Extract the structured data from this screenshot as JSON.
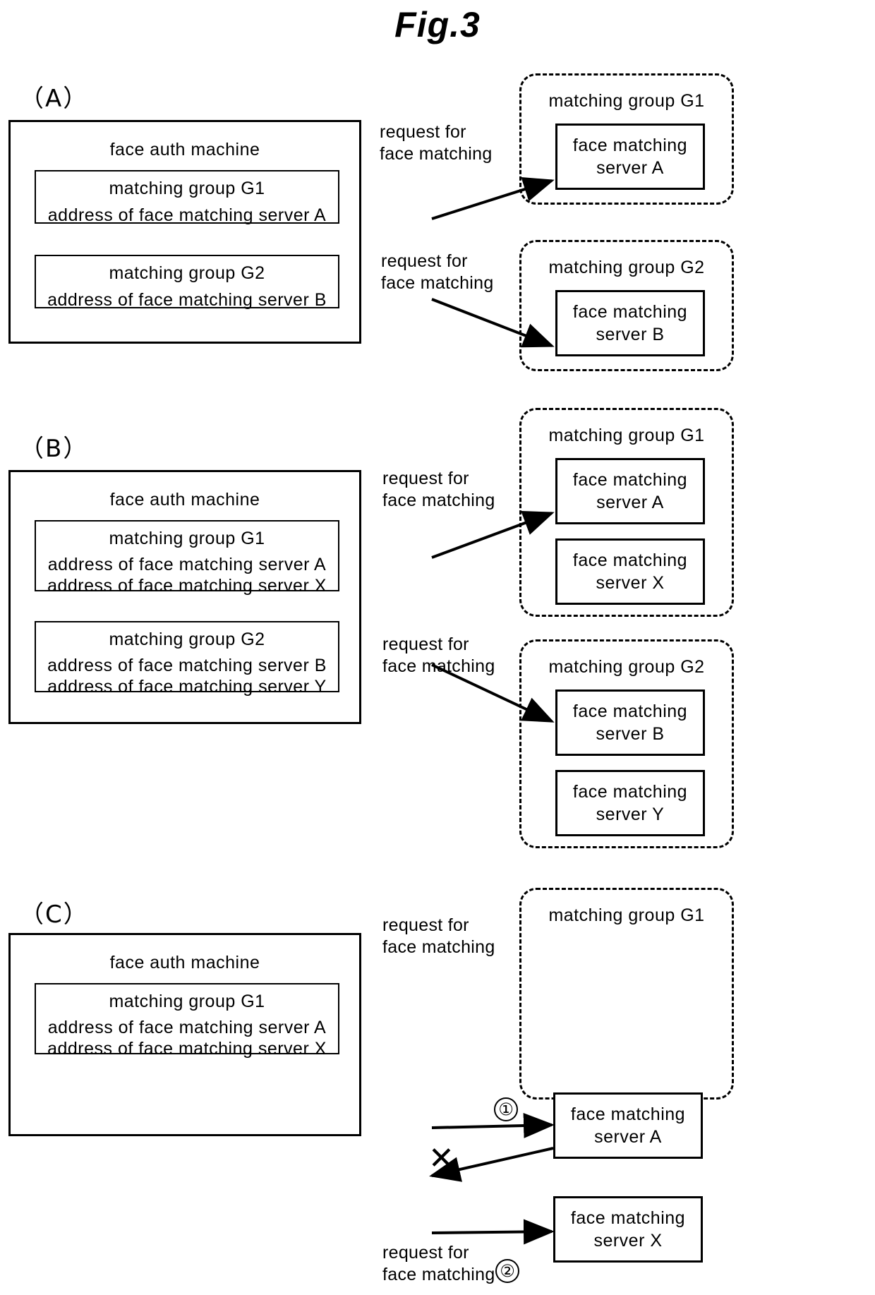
{
  "figure": {
    "title": "Fig.3"
  },
  "panels": [
    {
      "label": "（A）",
      "auth_machine": {
        "title": "face auth machine",
        "groups": [
          {
            "title": "matching group G1",
            "addresses": [
              "address of face matching server A"
            ]
          },
          {
            "title": "matching group G2",
            "addresses": [
              "address of face matching server B"
            ]
          }
        ]
      },
      "arrows": [
        {
          "caption_line1": "request for",
          "caption_line2": "face matching",
          "number": ""
        },
        {
          "caption_line1": "request for",
          "caption_line2": "face matching",
          "number": ""
        }
      ],
      "matching_groups": [
        {
          "title": "matching group G1",
          "servers": [
            {
              "line1": "face matching",
              "line2": "server A"
            }
          ]
        },
        {
          "title": "matching group G2",
          "servers": [
            {
              "line1": "face matching",
              "line2": "server B"
            }
          ]
        }
      ]
    },
    {
      "label": "（B）",
      "auth_machine": {
        "title": "face auth machine",
        "groups": [
          {
            "title": "matching group G1",
            "addresses": [
              "address of face matching server A",
              "address of face matching server X"
            ]
          },
          {
            "title": "matching group G2",
            "addresses": [
              "address of face matching server B",
              "address of face matching server Y"
            ]
          }
        ]
      },
      "arrows": [
        {
          "caption_line1": "request for",
          "caption_line2": "face matching",
          "number": ""
        },
        {
          "caption_line1": "request for",
          "caption_line2": "face matching",
          "number": ""
        }
      ],
      "matching_groups": [
        {
          "title": "matching group G1",
          "servers": [
            {
              "line1": "face matching",
              "line2": "server A"
            },
            {
              "line1": "face matching",
              "line2": "server X"
            }
          ]
        },
        {
          "title": "matching group G2",
          "servers": [
            {
              "line1": "face matching",
              "line2": "server B"
            },
            {
              "line1": "face matching",
              "line2": "server Y"
            }
          ]
        }
      ]
    },
    {
      "label": "（C）",
      "auth_machine": {
        "title": "face auth machine",
        "groups": [
          {
            "title": "matching group G1",
            "addresses": [
              "address of face matching server A",
              "address of face matching server X"
            ]
          }
        ]
      },
      "arrows": [
        {
          "caption_line1": "request for",
          "caption_line2": "face matching",
          "number": "①"
        },
        {
          "caption_line1": "request for",
          "caption_line2": "face matching",
          "number": "②"
        }
      ],
      "failure_mark": "✕",
      "matching_groups": [
        {
          "title": "matching group G1",
          "servers": [
            {
              "line1": "face matching",
              "line2": "server A"
            },
            {
              "line1": "face matching",
              "line2": "server X"
            }
          ]
        }
      ]
    }
  ]
}
